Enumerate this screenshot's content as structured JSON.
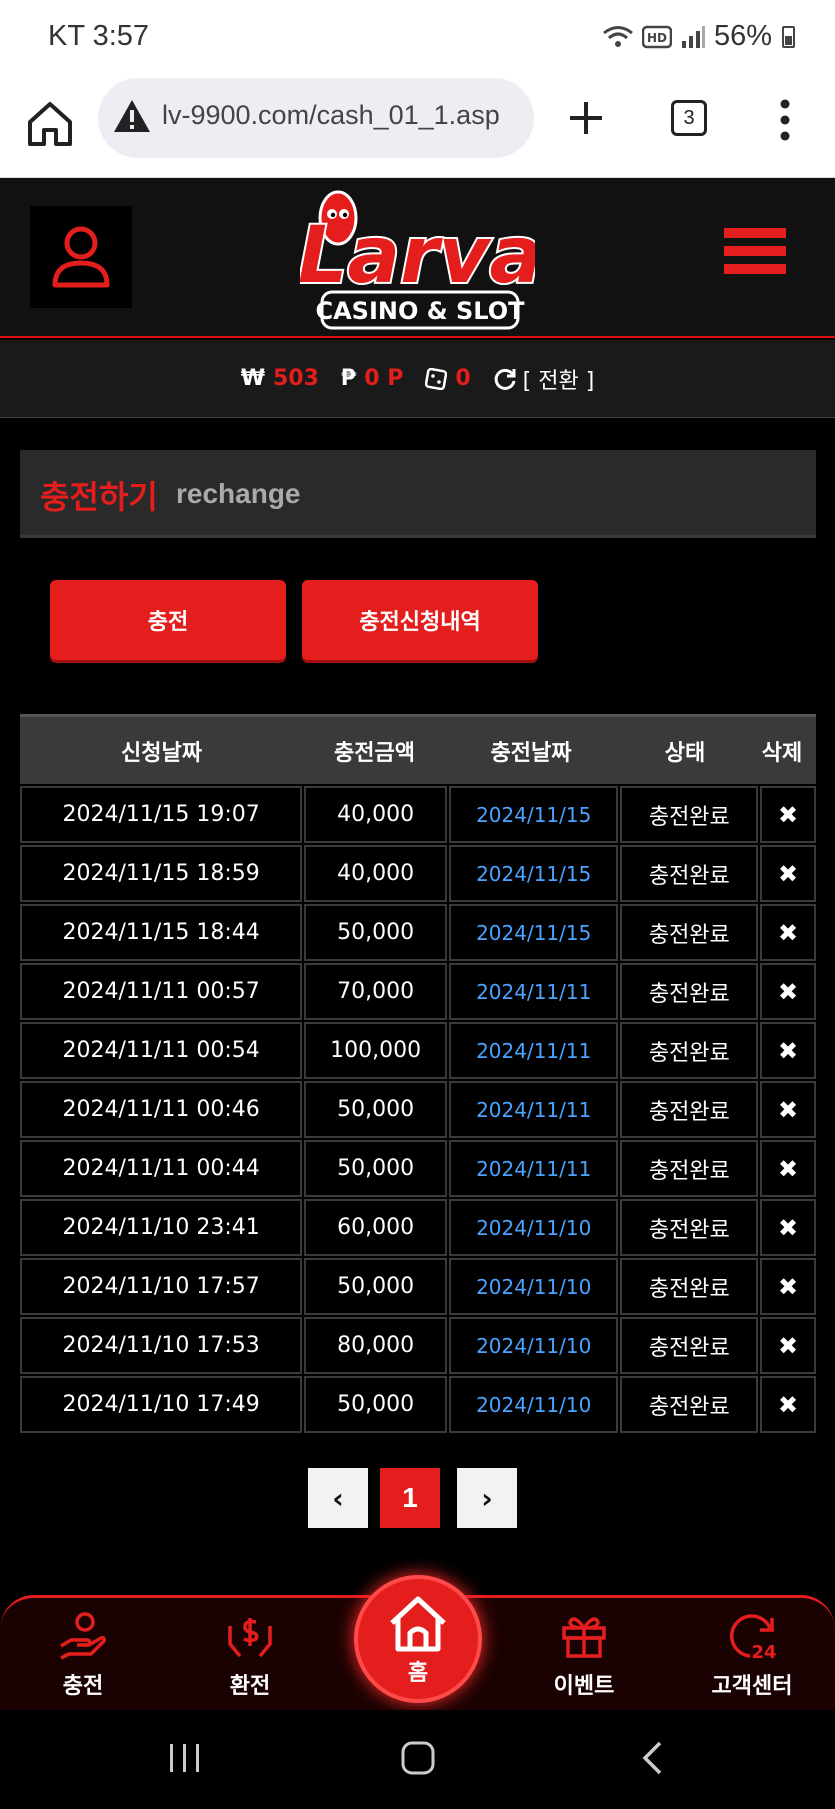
{
  "status": {
    "carrier_time": "KT 3:57",
    "battery": "56%"
  },
  "browser": {
    "url": "lv-9900.com/cash_01_1.asp",
    "tab_count": "3"
  },
  "header": {
    "logo_top": "Larva",
    "logo_bottom": "CASINO & SLOT"
  },
  "balance": {
    "won_symbol": "₩",
    "won_value": "503",
    "point_symbol": "₱",
    "point_value": "0 P",
    "chip_value": "0",
    "switch_label": "[ 전환 ]"
  },
  "page_title": {
    "ko": "충전하기",
    "en": "rechange"
  },
  "actions": {
    "charge_label": "충전",
    "history_label": "충전신청내역"
  },
  "table": {
    "headers": [
      "신청날짜",
      "충전금액",
      "충전날짜",
      "상태",
      "삭제"
    ],
    "rows": [
      {
        "requested": "2024/11/15 19:07",
        "amount": "40,000",
        "charged": "2024/11/15",
        "status": "충전완료",
        "delete": "✖"
      },
      {
        "requested": "2024/11/15 18:59",
        "amount": "40,000",
        "charged": "2024/11/15",
        "status": "충전완료",
        "delete": "✖"
      },
      {
        "requested": "2024/11/15 18:44",
        "amount": "50,000",
        "charged": "2024/11/15",
        "status": "충전완료",
        "delete": "✖"
      },
      {
        "requested": "2024/11/11 00:57",
        "amount": "70,000",
        "charged": "2024/11/11",
        "status": "충전완료",
        "delete": "✖"
      },
      {
        "requested": "2024/11/11 00:54",
        "amount": "100,000",
        "charged": "2024/11/11",
        "status": "충전완료",
        "delete": "✖"
      },
      {
        "requested": "2024/11/11 00:46",
        "amount": "50,000",
        "charged": "2024/11/11",
        "status": "충전완료",
        "delete": "✖"
      },
      {
        "requested": "2024/11/11 00:44",
        "amount": "50,000",
        "charged": "2024/11/11",
        "status": "충전완료",
        "delete": "✖"
      },
      {
        "requested": "2024/11/10 23:41",
        "amount": "60,000",
        "charged": "2024/11/10",
        "status": "충전완료",
        "delete": "✖"
      },
      {
        "requested": "2024/11/10 17:57",
        "amount": "50,000",
        "charged": "2024/11/10",
        "status": "충전완료",
        "delete": "✖"
      },
      {
        "requested": "2024/11/10 17:53",
        "amount": "80,000",
        "charged": "2024/11/10",
        "status": "충전완료",
        "delete": "✖"
      },
      {
        "requested": "2024/11/10 17:49",
        "amount": "50,000",
        "charged": "2024/11/10",
        "status": "충전완료",
        "delete": "✖"
      }
    ]
  },
  "pagination": {
    "prev": "‹",
    "current": "1",
    "next": "›"
  },
  "bottom_nav": {
    "charge": "충전",
    "exchange": "환전",
    "home": "홈",
    "event": "이벤트",
    "support": "고객센터"
  },
  "colors": {
    "accent": "#e41d1d",
    "link_blue": "#4aa3ff",
    "header_bg": "#111111"
  }
}
